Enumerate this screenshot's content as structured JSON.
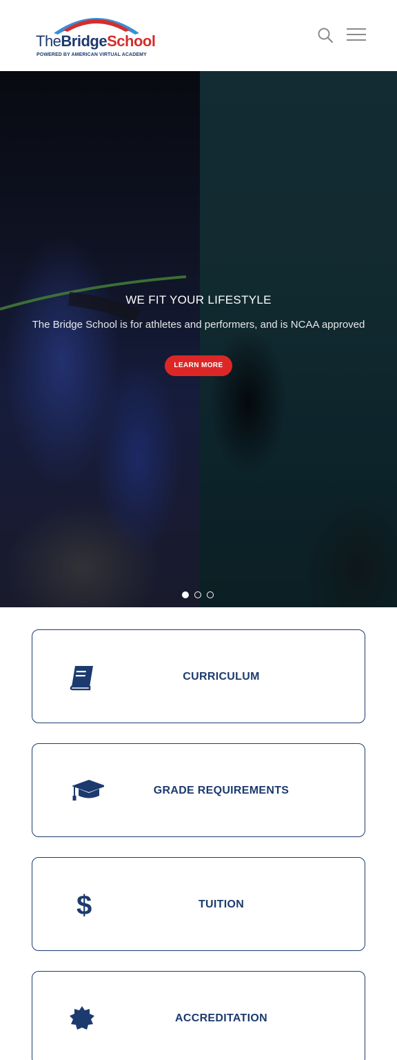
{
  "header": {
    "logo": {
      "the": "The",
      "bridge": "Bridge",
      "school": "School",
      "tagline": "POWERED BY AMERICAN VIRTUAL ACADEMY"
    },
    "search_icon": "search-icon",
    "menu_icon": "hamburger-menu-icon"
  },
  "hero": {
    "title": "WE FIT YOUR LIFESTYLE",
    "subtitle": "The Bridge School is for athletes and performers, and is NCAA approved",
    "cta_label": "LEARN MORE",
    "slides_total": 3,
    "active_slide": 1
  },
  "cards": [
    {
      "label": "CURRICULUM",
      "icon": "book-icon"
    },
    {
      "label": "GRADE REQUIREMENTS",
      "icon": "graduation-cap-icon"
    },
    {
      "label": "TUITION",
      "icon": "dollar-icon"
    },
    {
      "label": "ACCREDITATION",
      "icon": "certificate-badge-icon"
    }
  ],
  "colors": {
    "brand_navy": "#1c3a6e",
    "brand_red": "#d42e2e",
    "cta_red": "#dd2727"
  }
}
